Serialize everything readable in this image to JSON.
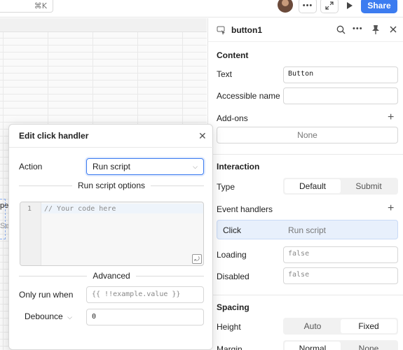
{
  "topbar": {
    "shortcut": "⌘K",
    "share_label": "Share",
    "more_icon": "more-dots-icon",
    "expand_icon": "expand-icon",
    "play_icon": "play-icon"
  },
  "inspector": {
    "component_name": "button1",
    "content": {
      "title": "Content",
      "text_label": "Text",
      "text_value": "Button",
      "accessible_name_label": "Accessible name",
      "accessible_name_value": "",
      "addons_label": "Add-ons",
      "addons_value": "None"
    },
    "interaction": {
      "title": "Interaction",
      "type_label": "Type",
      "type_options": [
        "Default",
        "Submit"
      ],
      "type_selected": "Default",
      "event_handlers_label": "Event handlers",
      "handler_event": "Click",
      "handler_action": "Run script",
      "loading_label": "Loading",
      "loading_value": "false",
      "disabled_label": "Disabled",
      "disabled_value": "false"
    },
    "spacing": {
      "title": "Spacing",
      "height_label": "Height",
      "height_options": [
        "Auto",
        "Fixed"
      ],
      "height_selected": "Fixed",
      "margin_label": "Margin",
      "margin_options": [
        "Normal",
        "None"
      ],
      "margin_selected": "Normal"
    }
  },
  "modal": {
    "title": "Edit click handler",
    "action_label": "Action",
    "action_value": "Run script",
    "options_heading": "Run script options",
    "editor_line_number": "1",
    "editor_code": "// Your code here",
    "advanced_heading": "Advanced",
    "only_run_when_label": "Only run when",
    "only_run_when_placeholder": "{{ !!example.value }}",
    "debounce_label": "Debounce",
    "debounce_value": "0"
  },
  "canvas": {
    "partial_texts": [
      "pe",
      "Sel"
    ]
  },
  "colors": {
    "accent": "#3c7cf0",
    "selected_handler_bg": "#e8f0fc"
  }
}
